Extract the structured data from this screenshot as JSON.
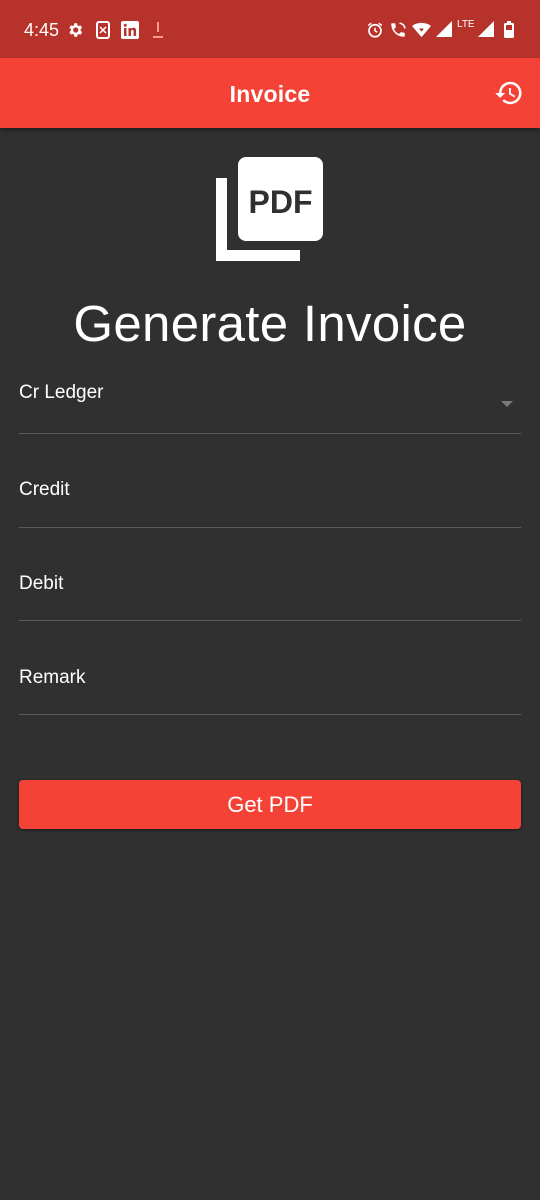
{
  "status_bar": {
    "time": "4:45",
    "network": "LTE",
    "icons": [
      "settings-icon",
      "phone-screen-icon",
      "linkedin-icon",
      "download-icon",
      "alarm-icon",
      "wifi-call-icon",
      "wifi-icon",
      "signal-icon",
      "battery-icon"
    ]
  },
  "app_bar": {
    "title": "Invoice",
    "action_icon": "history-icon"
  },
  "hero": {
    "icon": "pdf-icon",
    "icon_text": "PDF",
    "title": "Generate Invoice"
  },
  "form": {
    "fields": [
      {
        "label": "Cr Ledger",
        "type": "dropdown"
      },
      {
        "label": "Credit",
        "type": "text"
      },
      {
        "label": "Debit",
        "type": "text"
      },
      {
        "label": "Remark",
        "type": "text"
      }
    ],
    "submit_label": "Get PDF"
  },
  "colors": {
    "primary": "#f44336",
    "status_bar": "#b7322a",
    "background": "#303030"
  }
}
